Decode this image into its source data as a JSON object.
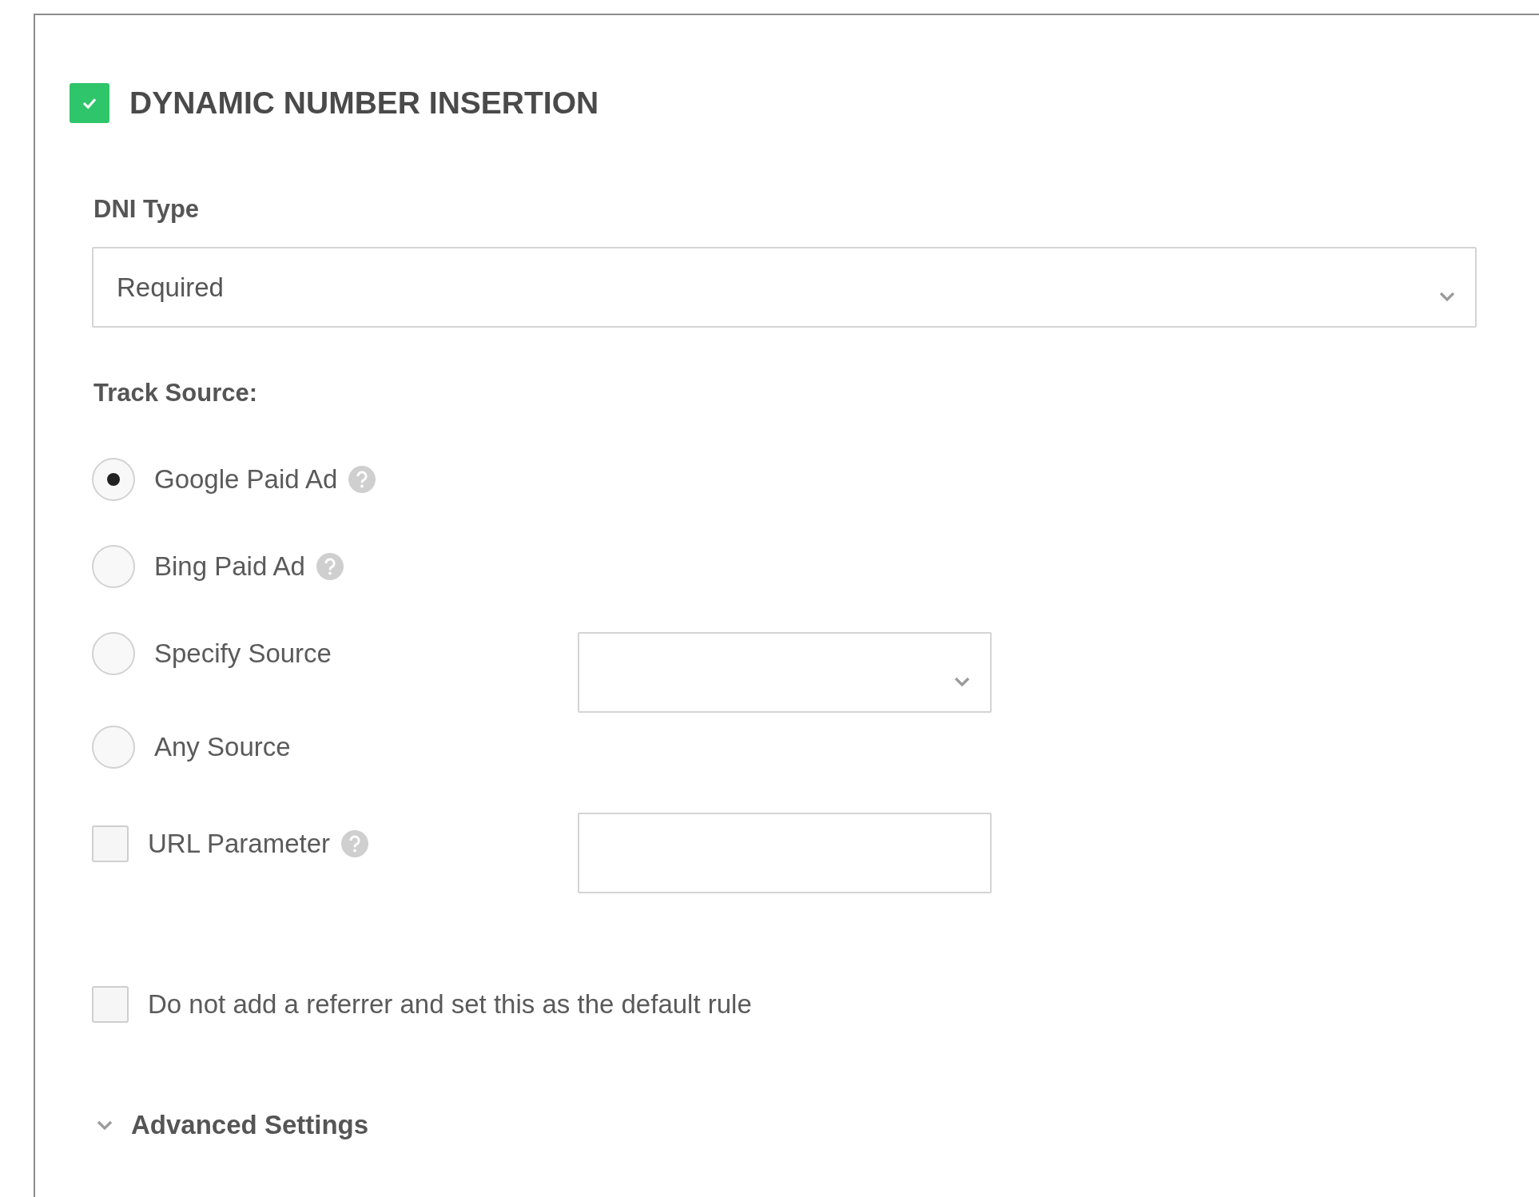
{
  "section": {
    "title": "DYNAMIC NUMBER INSERTION",
    "enabled": true
  },
  "dni_type": {
    "label": "DNI Type",
    "value": "Required"
  },
  "track_source": {
    "label": "Track Source:",
    "options": [
      {
        "kind": "radio",
        "label": "Google Paid Ad",
        "selected": true,
        "help": true
      },
      {
        "kind": "radio",
        "label": "Bing Paid Ad",
        "selected": false,
        "help": true
      },
      {
        "kind": "radio",
        "label": "Specify Source",
        "selected": false,
        "help": false,
        "dropdown": true
      },
      {
        "kind": "radio",
        "label": "Any Source",
        "selected": false,
        "help": false
      },
      {
        "kind": "checkbox",
        "label": "URL Parameter",
        "checked": false,
        "help": true,
        "text_field": true
      }
    ]
  },
  "default_rule": {
    "label": "Do not add a referrer and set this as the default rule",
    "checked": false
  },
  "advanced": {
    "label": "Advanced Settings"
  }
}
